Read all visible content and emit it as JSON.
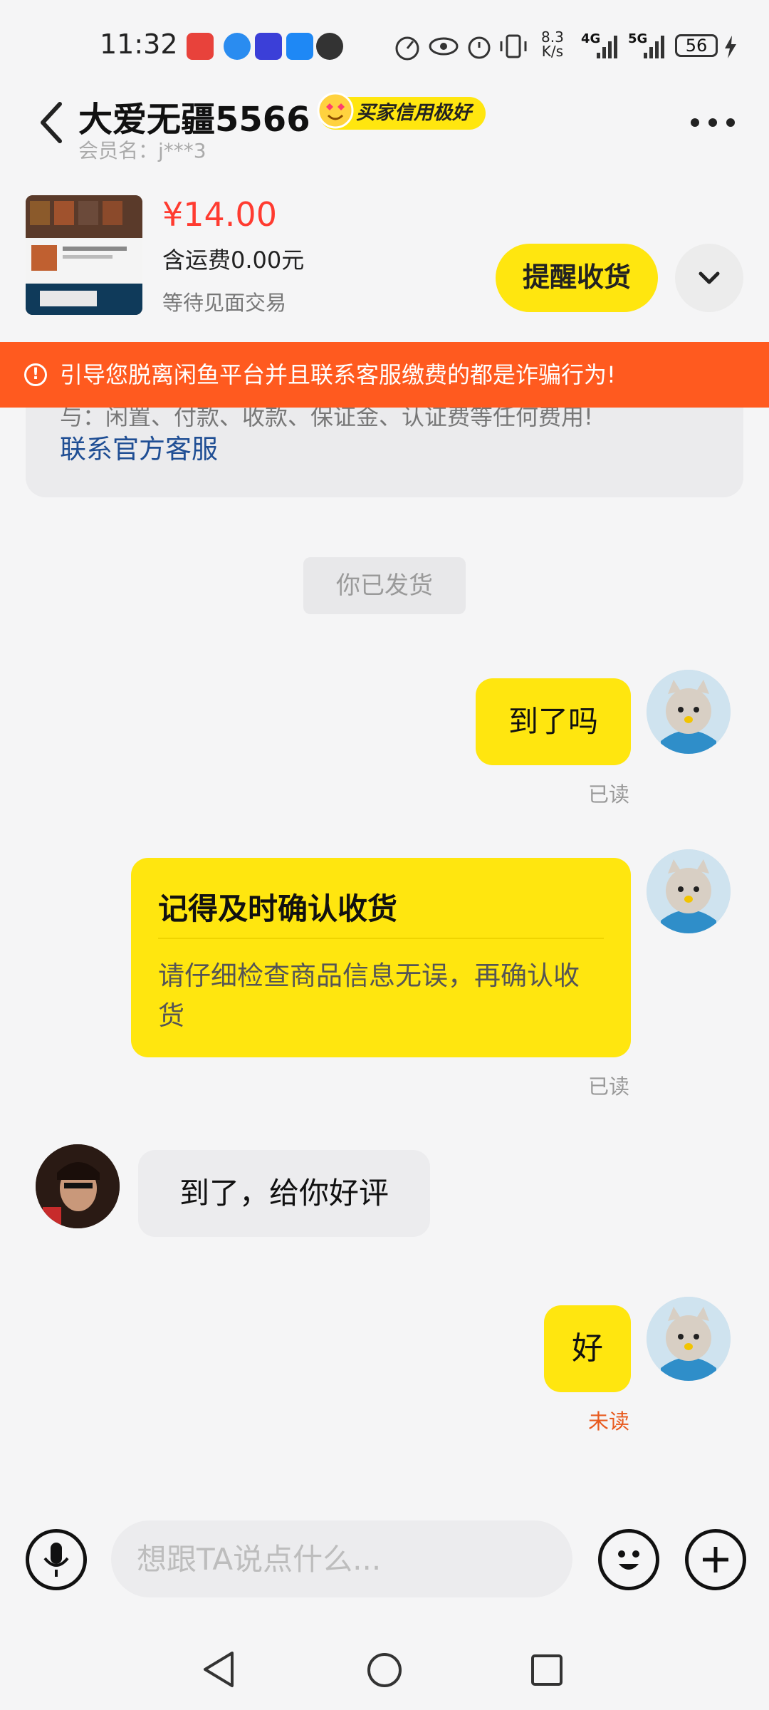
{
  "status_bar": {
    "time": "11:32",
    "net_speed_value": "8.3",
    "net_speed_unit": "K/s",
    "net1": "4G",
    "net2": "5G",
    "battery": "56"
  },
  "header": {
    "title": "大爱无疆5566",
    "badge": "买家信用极好",
    "member": "会员名：j***3"
  },
  "product": {
    "price": "¥14.00",
    "shipping": "含运费0.00元",
    "status": "等待见面交易",
    "remind_button": "提醒收货"
  },
  "warning": {
    "text": "引导您脱离闲鱼平台并且联系客服缴费的都是诈骗行为!"
  },
  "notice": {
    "partial_text": "与：闲置、付款、收款、保证金、认证费等任何费用!",
    "contact_link": "联系官方客服"
  },
  "system_message": "你已发货",
  "messages": [
    {
      "text": "到了吗",
      "status": "已读"
    },
    {
      "card_title": "记得及时确认收货",
      "card_body": "请仔细检查商品信息无误，再确认收货",
      "status": "已读"
    },
    {
      "text": "到了，给你好评"
    },
    {
      "text": "好",
      "status": "未读"
    }
  ],
  "input": {
    "placeholder": "想跟TA说点什么..."
  },
  "colors": {
    "accent_yellow": "#ffe60f",
    "price_red": "#ff3b30",
    "warning_orange": "#ff5a1f",
    "link_blue": "#1f4e94",
    "unread_orange": "#e85a1e"
  }
}
